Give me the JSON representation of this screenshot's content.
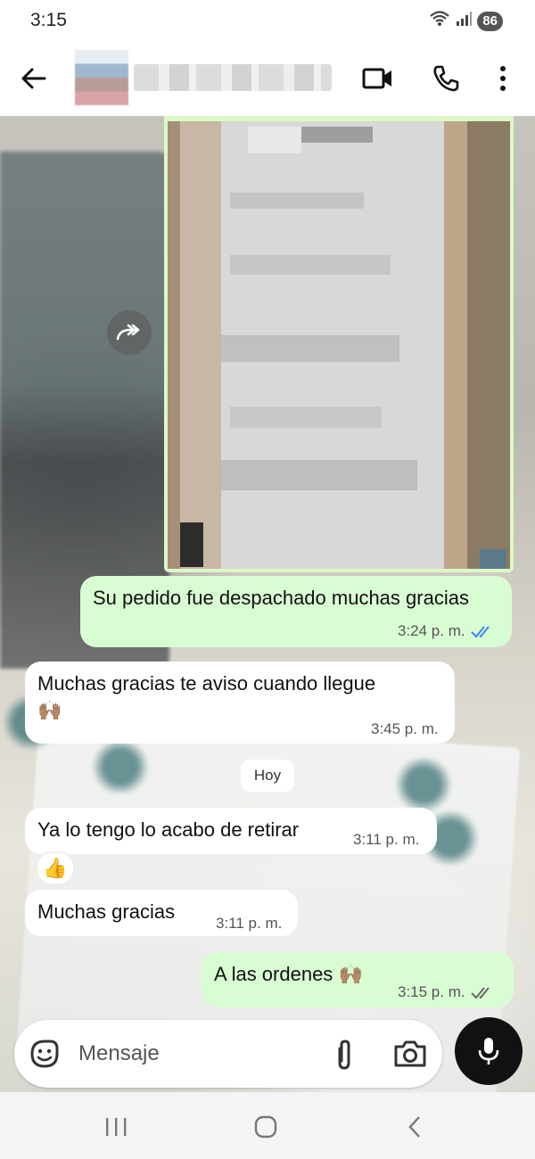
{
  "status": {
    "time": "3:15",
    "battery": "86"
  },
  "header": {
    "contact_name": ""
  },
  "messages": [
    {
      "text": "Su pedido fue despachado muchas gracias",
      "time": "3:24 p. m."
    },
    {
      "text": "Muchas gracias te aviso cuando llegue",
      "emoji": "🙌🏽",
      "time": "3:45 p. m."
    },
    {
      "text": "Ya lo tengo lo acabo de retirar",
      "time": "3:11 p. m.",
      "reaction": "👍"
    },
    {
      "text": "Muchas gracias",
      "time": "3:11 p. m."
    },
    {
      "text": "A las ordenes",
      "emoji": "🙌🏽",
      "time": "3:15 p. m."
    }
  ],
  "day_separator": "Hoy",
  "composer": {
    "placeholder": "Mensaje"
  },
  "colors": {
    "outgoing": "#d9fdd3",
    "incoming": "#ffffff",
    "read_tick": "#3b82f6"
  },
  "icons": [
    "back-arrow-icon",
    "video-call-icon",
    "phone-icon",
    "more-vertical-icon",
    "forward-icon",
    "sticker-icon",
    "attach-icon",
    "camera-icon",
    "mic-icon",
    "recents-icon",
    "home-icon",
    "back-nav-icon"
  ]
}
